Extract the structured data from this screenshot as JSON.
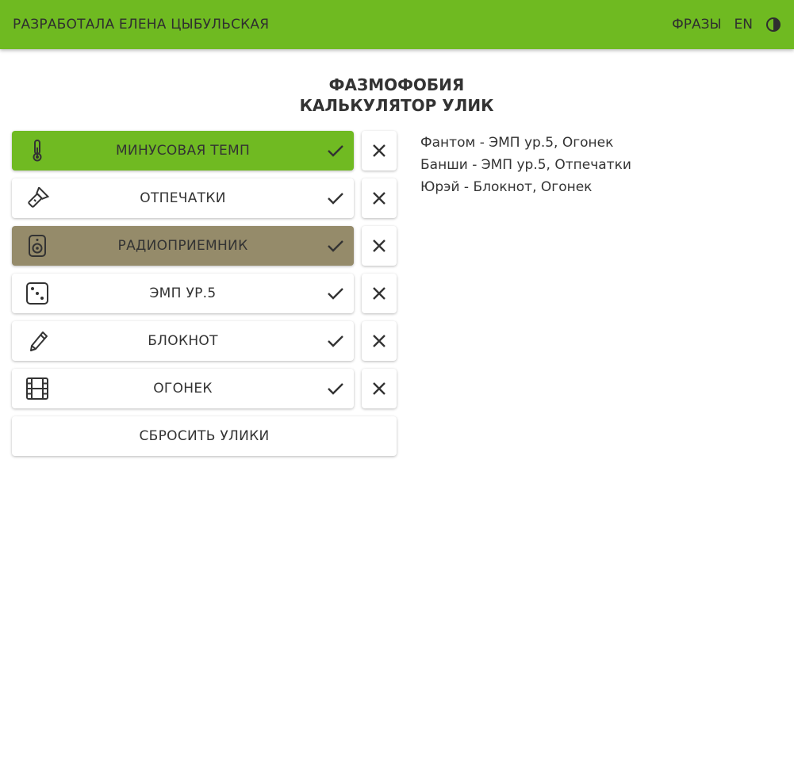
{
  "header": {
    "author": "РАЗРАБОТАЛА ЕЛЕНА ЦЫБУЛЬСКАЯ",
    "phrases_link": "ФРАЗЫ",
    "language_link": "EN",
    "theme_icon": "contrast-icon"
  },
  "title": {
    "line1": "ФАЗМОФОБИЯ",
    "line2": "КАЛЬКУЛЯТОР УЛИК"
  },
  "evidence": [
    {
      "label": "МИНУСОВАЯ ТЕМП",
      "icon": "thermometer-icon",
      "state": "selected"
    },
    {
      "label": "ОТПЕЧАТКИ",
      "icon": "flashlight-icon",
      "state": "none"
    },
    {
      "label": "РАДИОПРИЕМНИК",
      "icon": "speaker-icon",
      "state": "excluded-style"
    },
    {
      "label": "ЭМП УР.5",
      "icon": "dice-icon",
      "state": "none"
    },
    {
      "label": "БЛОКНОТ",
      "icon": "pencil-icon",
      "state": "none"
    },
    {
      "label": "ОГОНЕК",
      "icon": "film-icon",
      "state": "none"
    }
  ],
  "reset_label": "СБРОСИТЬ УЛИКИ",
  "results": [
    "Фантом - ЭМП ур.5, Огонек",
    "Банши - ЭМП ур.5, Отпечатки",
    "Юрэй - Блокнот, Огонек"
  ],
  "colors": {
    "accent": "#6fba21",
    "selected": "#70ba22",
    "excluded": "#958b6a",
    "text": "#333333"
  }
}
